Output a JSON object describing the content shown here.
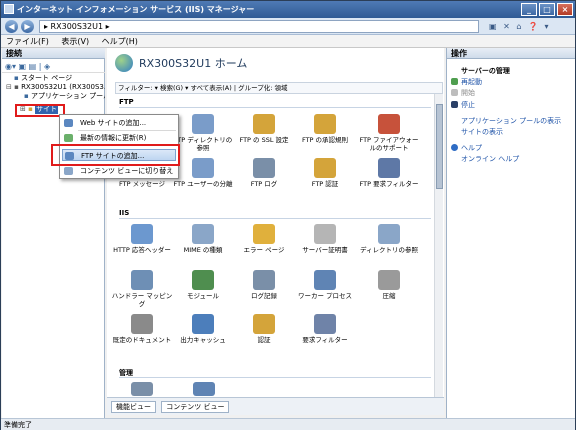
{
  "window": {
    "title": "インターネット インフォメーション サービス (IIS) マネージャー"
  },
  "address": {
    "path": "▸ RX300S32U1 ▸"
  },
  "menu": [
    "ファイル(F)",
    "表示(V)",
    "ヘルプ(H)"
  ],
  "left": {
    "header": "接続",
    "tree": [
      "スタート ページ",
      "RX300S32U1 (RX300S3...",
      "アプリケーション プール",
      "サイト"
    ]
  },
  "context_menu": {
    "items": [
      "Web サイトの追加...",
      "最新の情報に更新(R)",
      "FTP サイトの追加...",
      "コンテンツ ビューに切り替え"
    ]
  },
  "center": {
    "title": "RX300S32U1 ホーム",
    "filter": "フィルター:     ▾ 検索(G) ▾  すべて表示(A) | グループ化: 領域",
    "groups": [
      "FTP",
      "IIS",
      "管理"
    ],
    "features": [
      {
        "label": "FTP ディレクトリの参照",
        "color": "#7a9cc9"
      },
      {
        "label": "FTP の SSL 設定",
        "color": "#d4a43a"
      },
      {
        "label": "FTP の承認規則",
        "color": "#d4a43a"
      },
      {
        "label": "FTP ファイアウォールのサポート",
        "color": "#c7523b"
      },
      {
        "label": "FTP メッセージ",
        "color": "#5b87c0"
      },
      {
        "label": "FTP ユーザーの分離",
        "color": "#7a9cc9"
      },
      {
        "label": "FTP ログ",
        "color": "#7a8fa8"
      },
      {
        "label": "FTP 認証",
        "color": "#d4a43a"
      },
      {
        "label": "FTP 要求フィルター",
        "color": "#5e78a6"
      },
      {
        "label": "HTTP 応答ヘッダー",
        "color": "#6c98cf"
      },
      {
        "label": "MIME の種類",
        "color": "#8aa6c8"
      },
      {
        "label": "エラー ページ",
        "color": "#e0b03c"
      },
      {
        "label": "サーバー証明書",
        "color": "#b5b5b5"
      },
      {
        "label": "ディレクトリの参照",
        "color": "#8aa6c8"
      },
      {
        "label": "ハンドラー マッピング",
        "color": "#6e8fb5"
      },
      {
        "label": "モジュール",
        "color": "#4f8e4f"
      },
      {
        "label": "ログ記録",
        "color": "#7a8fa8"
      },
      {
        "label": "ワーカー プロセス",
        "color": "#5f84b4"
      },
      {
        "label": "圧縮",
        "color": "#9a9a9a"
      },
      {
        "label": "既定のドキュメント",
        "color": "#8a8a8a"
      },
      {
        "label": "出力キャッシュ",
        "color": "#4c7ebb"
      },
      {
        "label": "認証",
        "color": "#d4a43a"
      },
      {
        "label": "要求フィルター",
        "color": "#6f83a8"
      }
    ],
    "tabs": [
      "機能ビュー",
      "コンテンツ ビュー"
    ]
  },
  "right": {
    "header": "操作",
    "sections": {
      "server": "サーバーの管理",
      "restart": "再起動",
      "start": "開始",
      "stop": "停止",
      "apppool": "アプリケーション プールの表示",
      "sites": "サイトの表示",
      "help": "ヘルプ",
      "online": "オンライン ヘルプ"
    }
  },
  "status": "準備完了"
}
